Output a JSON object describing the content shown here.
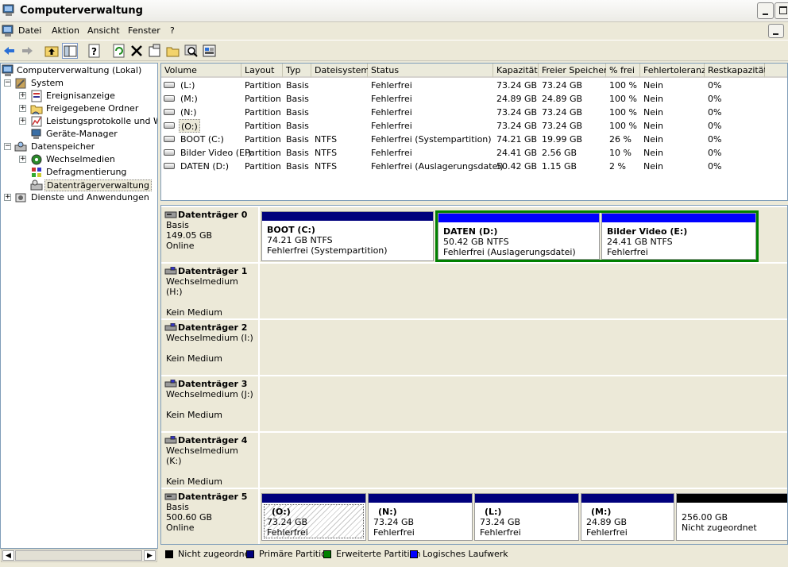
{
  "window": {
    "title": "Computerverwaltung"
  },
  "menu": [
    "Datei",
    "Aktion",
    "Ansicht",
    "Fenster",
    "?"
  ],
  "tree": {
    "root": "Computerverwaltung (Lokal)",
    "system": "System",
    "ereignis": "Ereignisanzeige",
    "freigabe": "Freigegebene Ordner",
    "leistung": "Leistungsprotokolle und Warn",
    "geraete": "Geräte-Manager",
    "datenspeicher": "Datenspeicher",
    "wechsel": "Wechselmedien",
    "defrag": "Defragmentierung",
    "dtv": "Datenträgerverwaltung",
    "dienste": "Dienste und Anwendungen"
  },
  "columns": [
    "Volume",
    "Layout",
    "Typ",
    "Dateisystem",
    "Status",
    "Kapazität",
    "Freier Speicher",
    "% frei",
    "Fehlertoleranz",
    "Restkapazität"
  ],
  "volumes": [
    [
      "(L:)",
      "Partition",
      "Basis",
      "",
      "Fehlerfrei",
      "73.24 GB",
      "73.24 GB",
      "100 %",
      "Nein",
      "0%"
    ],
    [
      "(M:)",
      "Partition",
      "Basis",
      "",
      "Fehlerfrei",
      "24.89 GB",
      "24.89 GB",
      "100 %",
      "Nein",
      "0%"
    ],
    [
      "(N:)",
      "Partition",
      "Basis",
      "",
      "Fehlerfrei",
      "73.24 GB",
      "73.24 GB",
      "100 %",
      "Nein",
      "0%"
    ],
    [
      "(O:)",
      "Partition",
      "Basis",
      "",
      "Fehlerfrei",
      "73.24 GB",
      "73.24 GB",
      "100 %",
      "Nein",
      "0%"
    ],
    [
      "BOOT (C:)",
      "Partition",
      "Basis",
      "NTFS",
      "Fehlerfrei (Systempartition)",
      "74.21 GB",
      "19.99 GB",
      "26 %",
      "Nein",
      "0%"
    ],
    [
      "Bilder Video (E:)",
      "Partition",
      "Basis",
      "NTFS",
      "Fehlerfrei",
      "24.41 GB",
      "2.56 GB",
      "10 %",
      "Nein",
      "0%"
    ],
    [
      "DATEN (D:)",
      "Partition",
      "Basis",
      "NTFS",
      "Fehlerfrei (Auslagerungsdatei)",
      "50.42 GB",
      "1.15 GB",
      "2 %",
      "Nein",
      "0%"
    ]
  ],
  "disks": {
    "d0": {
      "name": "Datenträger 0",
      "type": "Basis",
      "size": "149.05 GB",
      "status": "Online"
    },
    "d1": {
      "name": "Datenträger 1",
      "type": "Wechselmedium (H:)",
      "status": "Kein Medium"
    },
    "d2": {
      "name": "Datenträger 2",
      "type": "Wechselmedium (I:)",
      "status": "Kein Medium"
    },
    "d3": {
      "name": "Datenträger 3",
      "type": "Wechselmedium (J:)",
      "status": "Kein Medium"
    },
    "d4": {
      "name": "Datenträger 4",
      "type": "Wechselmedium (K:)",
      "status": "Kein Medium"
    },
    "d5": {
      "name": "Datenträger 5",
      "type": "Basis",
      "size": "500.60 GB",
      "status": "Online"
    }
  },
  "parts0": [
    {
      "name": "BOOT  (C:)",
      "size": "74.21 GB NTFS",
      "status": "Fehlerfrei (Systempartition)"
    },
    {
      "name": "DATEN  (D:)",
      "size": "50.42 GB NTFS",
      "status": "Fehlerfrei (Auslagerungsdatei)"
    },
    {
      "name": "Bilder Video  (E:)",
      "size": "24.41 GB NTFS",
      "status": "Fehlerfrei"
    }
  ],
  "parts5": [
    {
      "name": "(O:)",
      "size": "73.24 GB",
      "status": "Fehlerfrei"
    },
    {
      "name": "(N:)",
      "size": "73.24 GB",
      "status": "Fehlerfrei"
    },
    {
      "name": "(L:)",
      "size": "73.24 GB",
      "status": "Fehlerfrei"
    },
    {
      "name": "(M:)",
      "size": "24.89 GB",
      "status": "Fehlerfrei"
    },
    {
      "size": "256.00 GB",
      "status": "Nicht zugeordnet"
    }
  ],
  "legend": [
    "Nicht zugeordnet",
    "Primäre Partition",
    "Erweiterte Partition",
    "Logisches Laufwerk"
  ],
  "colors": {
    "primary": "#00007c",
    "extended": "#008000",
    "logical": "#0000ff",
    "unallocated": "#000000"
  }
}
